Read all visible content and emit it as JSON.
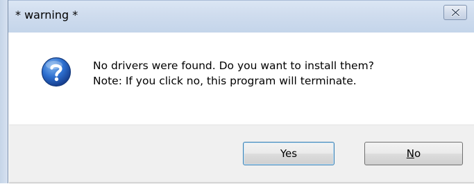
{
  "window": {
    "title": "* warning *"
  },
  "message": {
    "line1": "No drivers were found. Do you want to install them?",
    "line2": "Note: If you click no, this program will terminate."
  },
  "buttons": {
    "yes_label": "Yes",
    "no_label_prefix": "N",
    "no_label_suffix": "o"
  },
  "icons": {
    "dialog_icon": "question-icon",
    "close": "close-icon"
  },
  "colors": {
    "icon_blue": "#1f5fb8",
    "default_button_border": "#3c7fb1"
  }
}
